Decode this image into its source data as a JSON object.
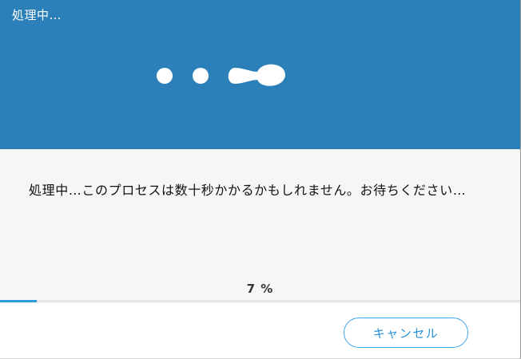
{
  "window": {
    "title": "処理中…"
  },
  "message": {
    "text": "処理中…このプロセスは数十秒かかるかもしれません。お待ちください…"
  },
  "progress": {
    "percent_text": "7 %",
    "value": 0.07
  },
  "footer": {
    "cancel_label": "キャンセル"
  },
  "colors": {
    "header_bg": "#2c80b9",
    "progress_fill": "#2c9ce0",
    "button_border": "#3fa6e8"
  }
}
